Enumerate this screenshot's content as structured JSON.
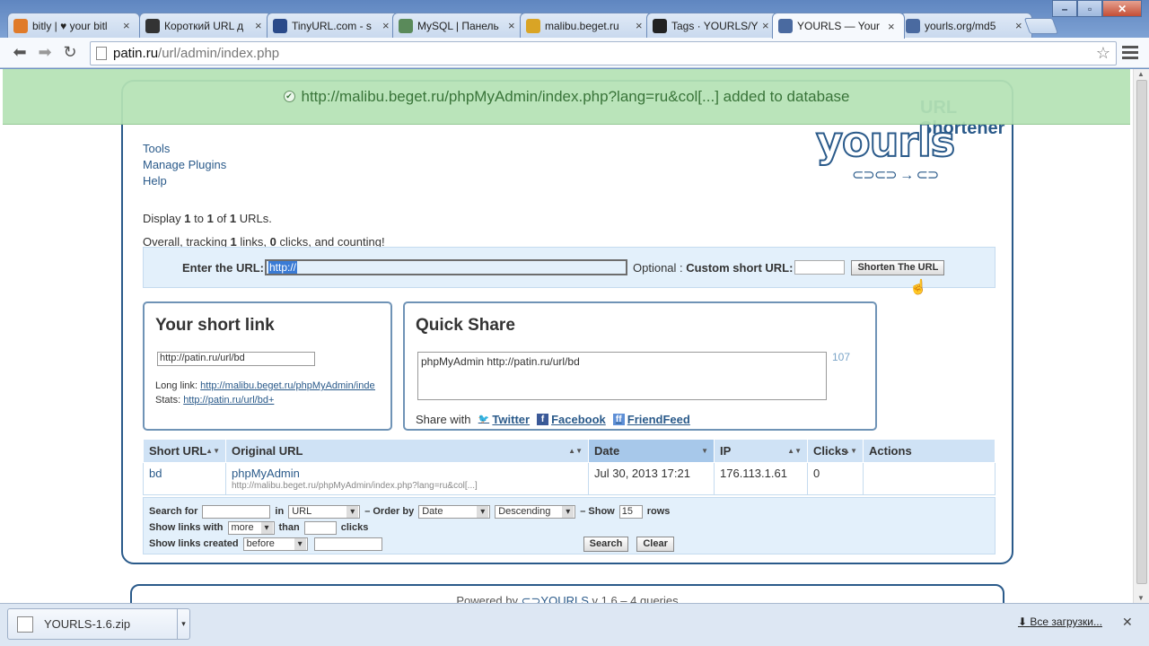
{
  "browser": {
    "tabs": [
      {
        "title": "bitly | ♥ your bitl",
        "icon_color": "#e07b2a"
      },
      {
        "title": "Короткий URL д",
        "icon_color": "#333333"
      },
      {
        "title": "TinyURL.com - s",
        "icon_color": "#2a4a8a"
      },
      {
        "title": "MySQL | Панель",
        "icon_color": "#5a8a5a"
      },
      {
        "title": "malibu.beget.ru",
        "icon_color": "#d9a425"
      },
      {
        "title": "Tags · YOURLS/Y",
        "icon_color": "#222222"
      },
      {
        "title": "YOURLS — Your",
        "icon_color": "#4a6aa0",
        "active": true
      },
      {
        "title": "yourls.org/md5",
        "icon_color": "#4a6aa0"
      }
    ],
    "address_host": "patin.ru",
    "address_path": "/url/admin/index.php"
  },
  "notice": {
    "text": "http://malibu.beget.ru/phpMyAdmin/index.php?lang=ru&col[...] added to database"
  },
  "header": {
    "ghost_title": "URL Shortener"
  },
  "admin_menu": [
    "Tools",
    "Manage Plugins",
    "Help"
  ],
  "logo": {
    "text": "yourls",
    "tagline": "⊂⊃⊂⊃ → ⊂⊃"
  },
  "stats": {
    "display_prefix": "Display",
    "display_from": "1",
    "display_to_word": "to",
    "display_to": "1",
    "display_of_word": "of",
    "display_total": "1",
    "display_suffix": "URLs.",
    "overall_prefix": "Overall, tracking",
    "links": "1",
    "links_word": "links,",
    "clicks": "0",
    "clicks_suffix": "clicks, and counting!"
  },
  "add_form": {
    "label": "Enter the URL:",
    "url_value": "http://",
    "optional_label": "Optional :",
    "custom_label": "Custom short URL:",
    "button": "Shorten The URL"
  },
  "short_link": {
    "title": "Your short link",
    "value": "http://patin.ru/url/bd",
    "long_label": "Long link:",
    "long_value": "http://malibu.beget.ru/phpMyAdmin/index.php?lang=ru",
    "stats_label": "Stats:",
    "stats_value": "http://patin.ru/url/bd+"
  },
  "quick_share": {
    "title": "Quick Share",
    "text": "phpMyAdmin http://patin.ru/url/bd",
    "count": "107",
    "share_with": "Share with",
    "twitter": "Twitter",
    "facebook": "Facebook",
    "friendfeed": "FriendFeed"
  },
  "table": {
    "headers": [
      "Short URL",
      "Original URL",
      "Date",
      "IP",
      "Clicks",
      "Actions"
    ],
    "rows": [
      {
        "short": "bd",
        "title": "phpMyAdmin",
        "url": "http://malibu.beget.ru/phpMyAdmin/index.php?lang=ru&col[...]",
        "date": "Jul 30, 2013 17:21",
        "ip": "176.113.1.61",
        "clicks": "0"
      }
    ]
  },
  "filter": {
    "search_for": "Search for",
    "in": "in",
    "in_value": "URL",
    "order_by": "– Order by",
    "order_value": "Date",
    "direction": "Descending",
    "show": "– Show",
    "show_value": "15",
    "rows": "rows",
    "show_links_with": "Show links with",
    "more": "more",
    "than": "than",
    "clicks": "clicks",
    "show_links_created": "Show links created",
    "before": "before",
    "search_btn": "Search",
    "clear_btn": "Clear"
  },
  "footer": {
    "powered_by": "Powered by",
    "yourls": "YOURLS",
    "version": "v 1.6 – 4 queries"
  },
  "downloads": {
    "file": "YOURLS-1.6.zip",
    "all": "Все загрузки..."
  }
}
